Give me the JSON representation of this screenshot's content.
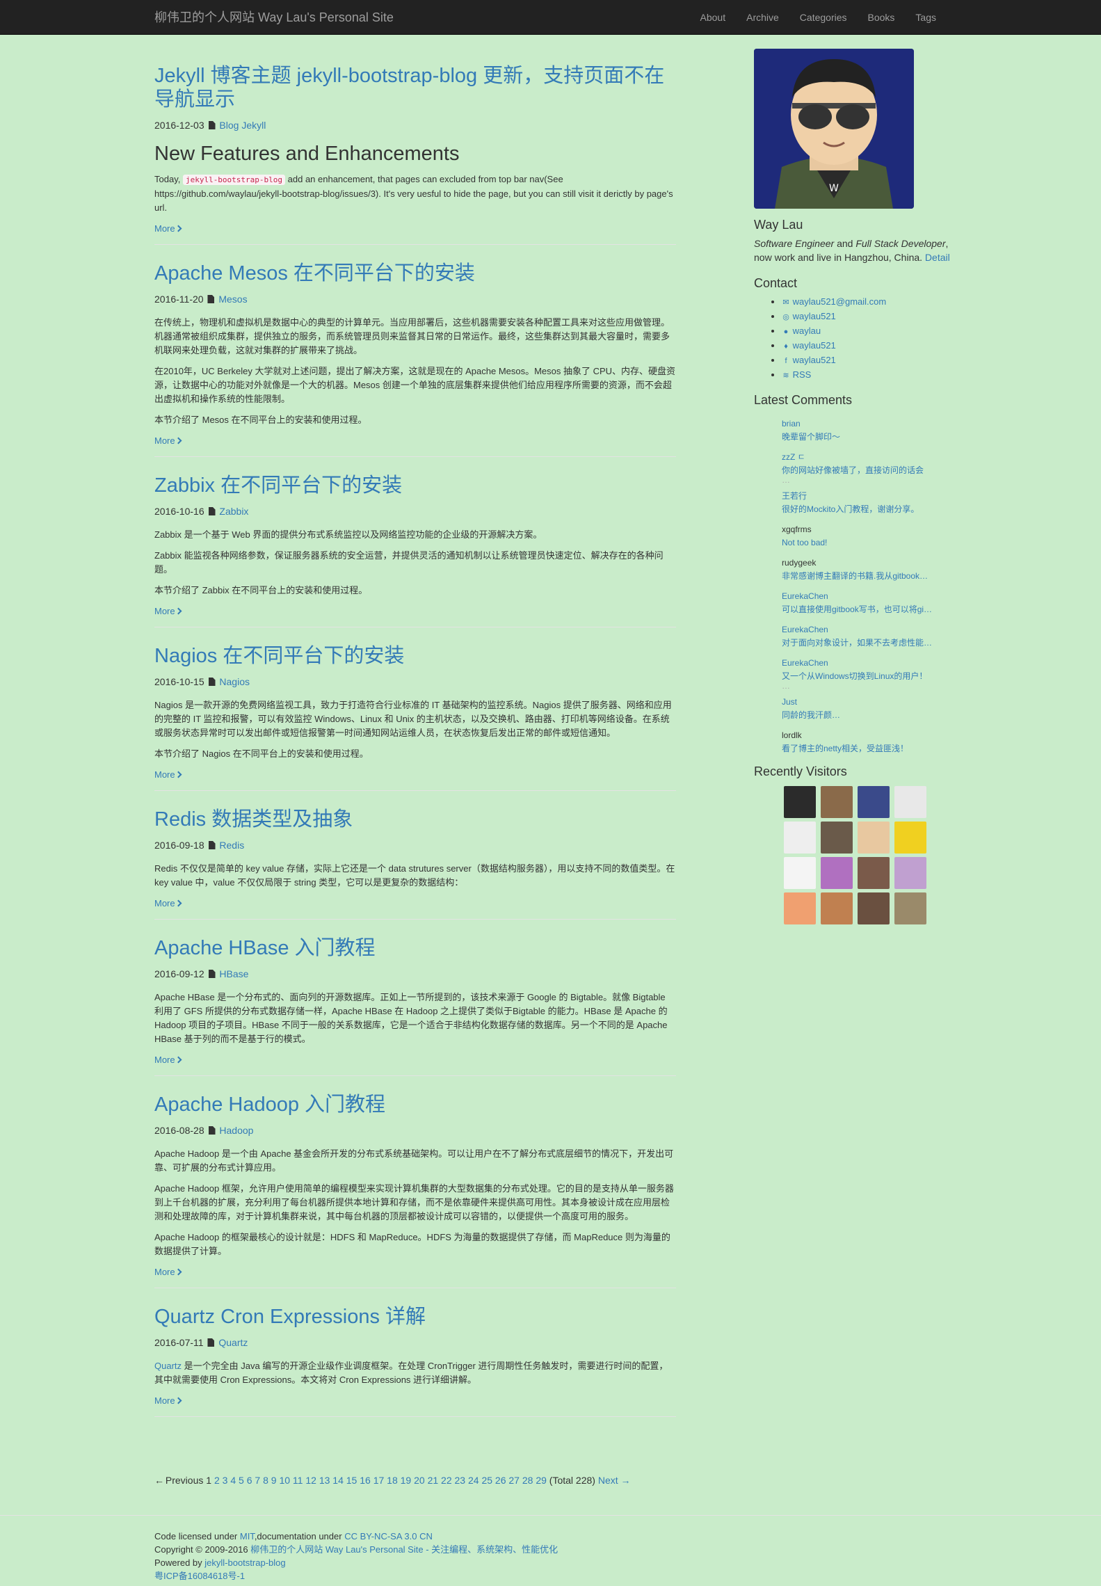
{
  "navbar": {
    "brand": "柳伟卫的个人网站 Way Lau's Personal Site",
    "links": [
      "About",
      "Archive",
      "Categories",
      "Books",
      "Tags"
    ]
  },
  "posts": [
    {
      "title": "Jekyll 博客主题 jekyll-bootstrap-blog 更新，支持页面不在导航显示",
      "date": "2016-12-03",
      "categories": "Blog Jekyll",
      "heading": "New Features and Enhancements",
      "p1_before": "Today, ",
      "p1_code": "jekyll-bootstrap-blog",
      "p1_after": " add an enhancement, that pages can excluded from top bar nav(See https://github.com/waylau/jekyll-bootstrap-blog/issues/3). It's very uesful to hide the page, but you can still visit it derictly by page's url.",
      "more": "More"
    },
    {
      "title": "Apache Mesos 在不同平台下的安装",
      "date": "2016-11-20",
      "categories": "Mesos",
      "paragraphs": [
        "在传统上，物理机和虚拟机是数据中心的典型的计算单元。当应用部署后，这些机器需要安装各种配置工具来对这些应用做管理。机器通常被组织成集群，提供独立的服务，而系统管理员则来监督其日常的日常运作。最终，这些集群达到其最大容量时，需要多机联网来处理负载，这就对集群的扩展带来了挑战。",
        "在2010年，UC Berkeley 大学就对上述问题，提出了解决方案，这就是现在的 Apache Mesos。Mesos 抽象了 CPU、内存、硬盘资源，让数据中心的功能对外就像是一个大的机器。Mesos 创建一个单独的底层集群来提供他们给应用程序所需要的资源，而不会超出虚拟机和操作系统的性能限制。",
        "本节介绍了 Mesos 在不同平台上的安装和使用过程。"
      ],
      "more": "More"
    },
    {
      "title": "Zabbix 在不同平台下的安装",
      "date": "2016-10-16",
      "categories": "Zabbix",
      "paragraphs": [
        "Zabbix 是一个基于 Web 界面的提供分布式系统监控以及网络监控功能的企业级的开源解决方案。",
        "Zabbix 能监视各种网络参数，保证服务器系统的安全运营，并提供灵活的通知机制以让系统管理员快速定位、解决存在的各种问题。",
        "本节介绍了 Zabbix 在不同平台上的安装和使用过程。"
      ],
      "more": "More"
    },
    {
      "title": "Nagios 在不同平台下的安装",
      "date": "2016-10-15",
      "categories": "Nagios",
      "paragraphs": [
        "Nagios 是一款开源的免费网络监视工具，致力于打造符合行业标准的 IT 基础架构的监控系统。Nagios 提供了服务器、网络和应用的完整的 IT 监控和报警，可以有效监控 Windows、Linux 和 Unix 的主机状态，以及交换机、路由器、打印机等网络设备。在系统或服务状态异常时可以发出邮件或短信报警第一时间通知网站运维人员，在状态恢复后发出正常的邮件或短信通知。",
        "本节介绍了 Nagios 在不同平台上的安装和使用过程。"
      ],
      "more": "More"
    },
    {
      "title": "Redis 数据类型及抽象",
      "date": "2016-09-18",
      "categories": "Redis",
      "paragraphs": [
        "Redis 不仅仅是简单的 key value 存储，实际上它还是一个 data strutures server（数据结构服务器），用以支持不同的数值类型。在 key value 中，value 不仅仅局限于 string 类型，它可以是更复杂的数据结构："
      ],
      "more": "More"
    },
    {
      "title": "Apache HBase 入门教程",
      "date": "2016-09-12",
      "categories": "HBase",
      "paragraphs": [
        "Apache HBase 是一个分布式的、面向列的开源数据库。正如上一节所提到的，该技术来源于 Google 的 Bigtable。就像 Bigtable 利用了 GFS 所提供的分布式数据存储一样，Apache HBase 在 Hadoop 之上提供了类似于Bigtable 的能力。HBase 是 Apache 的 Hadoop 项目的子项目。HBase 不同于一般的关系数据库，它是一个适合于非结构化数据存储的数据库。另一个不同的是 Apache HBase 基于列的而不是基于行的模式。"
      ],
      "more": "More"
    },
    {
      "title": "Apache Hadoop 入门教程",
      "date": "2016-08-28",
      "categories": "Hadoop",
      "paragraphs": [
        "Apache Hadoop 是一个由 Apache 基金会所开发的分布式系统基础架构。可以让用户在不了解分布式底层细节的情况下，开发出可靠、可扩展的分布式计算应用。",
        "Apache Hadoop 框架，允许用户使用简单的编程模型来实现计算机集群的大型数据集的分布式处理。它的目的是支持从单一服务器到上千台机器的扩展，充分利用了每台机器所提供本地计算和存储，而不是依靠硬件来提供高可用性。其本身被设计成在应用层检测和处理故障的库，对于计算机集群来说，其中每台机器的顶层都被设计成可以容错的，以便提供一个高度可用的服务。",
        "Apache Hadoop 的框架最核心的设计就是：HDFS 和 MapReduce。HDFS 为海量的数据提供了存储，而 MapReduce 则为海量的数据提供了计算。"
      ],
      "more": "More"
    },
    {
      "title": "Quartz Cron Expressions 详解",
      "date": "2016-07-11",
      "categories": "Quartz",
      "link_word": "Quartz",
      "p_after": " 是一个完全由 Java 编写的开源企业级作业调度框架。在处理 CronTrigger 进行周期性任务触发时，需要进行时间的配置，其中就需要使用 Cron Expressions。本文将对 Cron Expressions 进行详细讲解。",
      "more": "More"
    }
  ],
  "pager": {
    "previous": "Previous",
    "current": "1",
    "pages": [
      "2",
      "3",
      "4",
      "5",
      "6",
      "7",
      "8",
      "9",
      "10",
      "11",
      "12",
      "13",
      "14",
      "15",
      "16",
      "17",
      "18",
      "19",
      "20",
      "21",
      "22",
      "23",
      "24",
      "25",
      "26",
      "27",
      "28",
      "29"
    ],
    "total": "(Total 228)",
    "next": "Next"
  },
  "sidebar": {
    "name": "Way Lau",
    "bio_role1": "Software Engineer",
    "bio_and": " and ",
    "bio_role2": "Full Stack Developer",
    "bio_rest": ", now work and live in Hangzhou, China. ",
    "bio_link": "Detail",
    "contact_title": "Contact",
    "contacts": [
      {
        "icon": "envelope-icon",
        "glyph": "✉",
        "text": "waylau521@gmail.com"
      },
      {
        "icon": "weibo-icon",
        "glyph": "◎",
        "text": "waylau521"
      },
      {
        "icon": "github-icon",
        "glyph": "●",
        "text": "waylau"
      },
      {
        "icon": "twitter-icon",
        "glyph": "♦",
        "text": "waylau521"
      },
      {
        "icon": "facebook-icon",
        "glyph": "f",
        "text": "waylau521"
      },
      {
        "icon": "rss-icon",
        "glyph": "≋",
        "text": "RSS"
      }
    ],
    "comments_title": "Latest Comments",
    "comments": [
      {
        "author": "brian",
        "author_link": true,
        "text": "晚辈留个脚印～",
        "ellipsis": false
      },
      {
        "author": "zzZ ㄷ",
        "author_link": true,
        "text": "你的网站好像被墙了，直接访问的话会",
        "ellipsis": true
      },
      {
        "author": "王若行",
        "author_link": true,
        "text": "很好的Mockito入门教程，谢谢分享。",
        "ellipsis": false
      },
      {
        "author": "xgqfrms",
        "author_link": false,
        "text": "Not too bad!",
        "ellipsis": false
      },
      {
        "author": "rudygeek",
        "author_link": false,
        "text": "非常感谢博主翻译的书籍.我从gitbook…",
        "ellipsis": false
      },
      {
        "author": "EurekaChen",
        "author_link": true,
        "text": "可以直接使用gitbook写书，也可以将gi…",
        "ellipsis": false
      },
      {
        "author": "EurekaChen",
        "author_link": true,
        "text": "对于面向对象设计，如果不去考虑性能…",
        "ellipsis": false
      },
      {
        "author": "EurekaChen",
        "author_link": true,
        "text": "又一个从Windows切换到Linux的用户！",
        "ellipsis": true
      },
      {
        "author": "Just",
        "author_link": true,
        "text": "同龄的我汗颜…",
        "ellipsis": false
      },
      {
        "author": "lordlk",
        "author_link": false,
        "text": "看了博主的netty相关，受益匪浅！",
        "ellipsis": false
      }
    ],
    "visitors_title": "Recently Visitors",
    "visitor_colors": [
      "#2b2b2b",
      "#8a6a4a",
      "#3a4a8a",
      "#e8e8e8",
      "#eeeeee",
      "#6a5a4a",
      "#e8c8a0",
      "#f0d020",
      "#f4f4f4",
      "#b070c0",
      "#7a5a4a",
      "#c0a0d0",
      "#f0a070",
      "#c08050",
      "#6a5040",
      "#9a8a6a"
    ]
  },
  "footer": {
    "line1_pre": "Code licensed under ",
    "line1_mit": "MIT",
    "line1_mid": ",documentation under ",
    "line1_cc": "CC BY-NC-SA 3.0 CN",
    "line2_pre": "Copyright © 2009-2016 ",
    "line2_link": "柳伟卫的个人网站 Way Lau's Personal Site - 关注编程、系统架构、性能优化",
    "line3_pre": "Powered by ",
    "line3_link": "jekyll-bootstrap-blog",
    "line4": "粤ICP备16084618号-1"
  }
}
